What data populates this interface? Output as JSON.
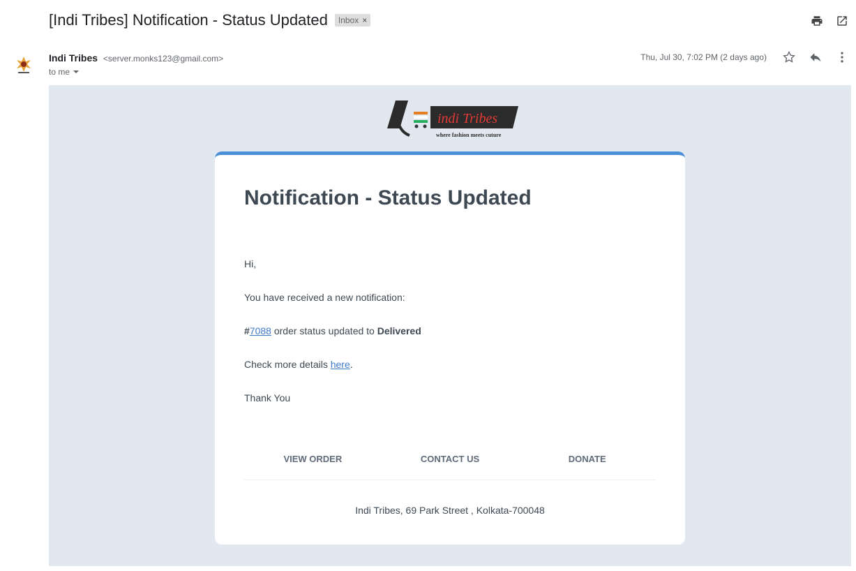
{
  "subject": "[Indi Tribes] Notification - Status Updated",
  "label": "Inbox",
  "sender": {
    "name": "Indi Tribes",
    "email": "<server.monks123@gmail.com>",
    "to": "to me",
    "date": "Thu, Jul 30, 7:02 PM (2 days ago)"
  },
  "logo": {
    "name": "indi Tribes",
    "tagline": "where fashion meets cuture"
  },
  "card": {
    "title": "Notification - Status Updated",
    "greeting": "Hi,",
    "intro": "You have received a new notification:",
    "order_prefix": "#",
    "order_id": "7088",
    "status_text": " order status updated to ",
    "status": "Delivered",
    "details_prefix": "Check more details ",
    "details_link": "here",
    "details_suffix": ".",
    "signoff": "Thank You"
  },
  "footer": {
    "links": [
      "VIEW ORDER",
      "CONTACT US",
      "DONATE"
    ],
    "address": "Indi Tribes, 69 Park Street , Kolkata-700048"
  },
  "colors": {
    "accent": "#4a90d9",
    "body_bg": "#e2e8f0",
    "link": "#3d7cc9"
  }
}
